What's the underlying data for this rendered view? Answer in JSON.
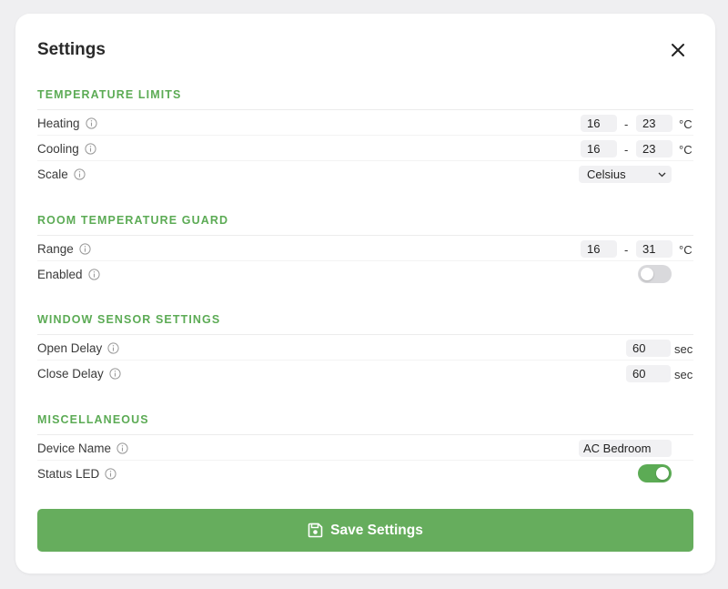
{
  "dialog": {
    "title": "Settings",
    "save_label": "Save Settings"
  },
  "sections": {
    "temperature_limits": {
      "title": "TEMPERATURE LIMITS",
      "heating": {
        "label": "Heating",
        "min": "16",
        "max": "23",
        "unit": "°C"
      },
      "cooling": {
        "label": "Cooling",
        "min": "16",
        "max": "23",
        "unit": "°C"
      },
      "scale": {
        "label": "Scale",
        "value": "Celsius"
      }
    },
    "room_guard": {
      "title": "ROOM TEMPERATURE GUARD",
      "range": {
        "label": "Range",
        "min": "16",
        "max": "31",
        "unit": "°C"
      },
      "enabled": {
        "label": "Enabled",
        "on": false
      }
    },
    "window_sensor": {
      "title": "WINDOW SENSOR SETTINGS",
      "open_delay": {
        "label": "Open Delay",
        "value": "60",
        "unit": "sec"
      },
      "close_delay": {
        "label": "Close Delay",
        "value": "60",
        "unit": "sec"
      }
    },
    "misc": {
      "title": "MISCELLANEOUS",
      "device_name": {
        "label": "Device Name",
        "value": "AC Bedroom"
      },
      "status_led": {
        "label": "Status LED",
        "on": true
      }
    }
  },
  "colors": {
    "accent": "#5cab55",
    "button": "#66ad5d",
    "toggle_off": "#d9d9dc",
    "background": "#efeff1"
  },
  "icons": {
    "close": "close-icon",
    "info": "info-icon",
    "dropdown": "chevron-down-icon",
    "save": "floppy-disk-icon"
  }
}
